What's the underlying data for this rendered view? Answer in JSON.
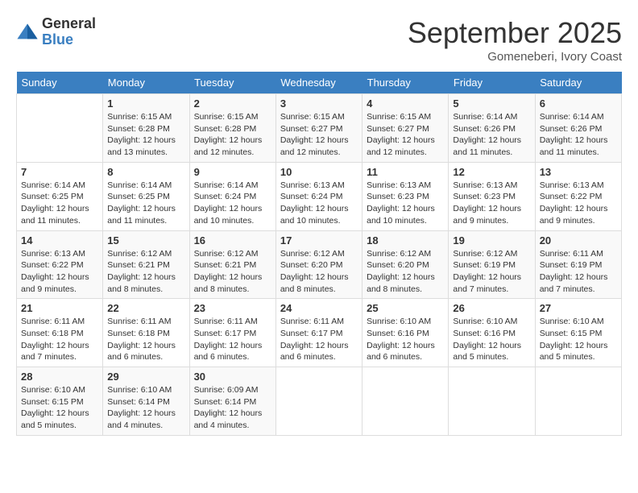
{
  "logo": {
    "line1": "General",
    "line2": "Blue"
  },
  "title": "September 2025",
  "subtitle": "Gomeneberi, Ivory Coast",
  "days_of_week": [
    "Sunday",
    "Monday",
    "Tuesday",
    "Wednesday",
    "Thursday",
    "Friday",
    "Saturday"
  ],
  "weeks": [
    [
      {
        "day": "",
        "info": ""
      },
      {
        "day": "1",
        "info": "Sunrise: 6:15 AM\nSunset: 6:28 PM\nDaylight: 12 hours\nand 13 minutes."
      },
      {
        "day": "2",
        "info": "Sunrise: 6:15 AM\nSunset: 6:28 PM\nDaylight: 12 hours\nand 12 minutes."
      },
      {
        "day": "3",
        "info": "Sunrise: 6:15 AM\nSunset: 6:27 PM\nDaylight: 12 hours\nand 12 minutes."
      },
      {
        "day": "4",
        "info": "Sunrise: 6:15 AM\nSunset: 6:27 PM\nDaylight: 12 hours\nand 12 minutes."
      },
      {
        "day": "5",
        "info": "Sunrise: 6:14 AM\nSunset: 6:26 PM\nDaylight: 12 hours\nand 11 minutes."
      },
      {
        "day": "6",
        "info": "Sunrise: 6:14 AM\nSunset: 6:26 PM\nDaylight: 12 hours\nand 11 minutes."
      }
    ],
    [
      {
        "day": "7",
        "info": "Sunrise: 6:14 AM\nSunset: 6:25 PM\nDaylight: 12 hours\nand 11 minutes."
      },
      {
        "day": "8",
        "info": "Sunrise: 6:14 AM\nSunset: 6:25 PM\nDaylight: 12 hours\nand 11 minutes."
      },
      {
        "day": "9",
        "info": "Sunrise: 6:14 AM\nSunset: 6:24 PM\nDaylight: 12 hours\nand 10 minutes."
      },
      {
        "day": "10",
        "info": "Sunrise: 6:13 AM\nSunset: 6:24 PM\nDaylight: 12 hours\nand 10 minutes."
      },
      {
        "day": "11",
        "info": "Sunrise: 6:13 AM\nSunset: 6:23 PM\nDaylight: 12 hours\nand 10 minutes."
      },
      {
        "day": "12",
        "info": "Sunrise: 6:13 AM\nSunset: 6:23 PM\nDaylight: 12 hours\nand 9 minutes."
      },
      {
        "day": "13",
        "info": "Sunrise: 6:13 AM\nSunset: 6:22 PM\nDaylight: 12 hours\nand 9 minutes."
      }
    ],
    [
      {
        "day": "14",
        "info": "Sunrise: 6:13 AM\nSunset: 6:22 PM\nDaylight: 12 hours\nand 9 minutes."
      },
      {
        "day": "15",
        "info": "Sunrise: 6:12 AM\nSunset: 6:21 PM\nDaylight: 12 hours\nand 8 minutes."
      },
      {
        "day": "16",
        "info": "Sunrise: 6:12 AM\nSunset: 6:21 PM\nDaylight: 12 hours\nand 8 minutes."
      },
      {
        "day": "17",
        "info": "Sunrise: 6:12 AM\nSunset: 6:20 PM\nDaylight: 12 hours\nand 8 minutes."
      },
      {
        "day": "18",
        "info": "Sunrise: 6:12 AM\nSunset: 6:20 PM\nDaylight: 12 hours\nand 8 minutes."
      },
      {
        "day": "19",
        "info": "Sunrise: 6:12 AM\nSunset: 6:19 PM\nDaylight: 12 hours\nand 7 minutes."
      },
      {
        "day": "20",
        "info": "Sunrise: 6:11 AM\nSunset: 6:19 PM\nDaylight: 12 hours\nand 7 minutes."
      }
    ],
    [
      {
        "day": "21",
        "info": "Sunrise: 6:11 AM\nSunset: 6:18 PM\nDaylight: 12 hours\nand 7 minutes."
      },
      {
        "day": "22",
        "info": "Sunrise: 6:11 AM\nSunset: 6:18 PM\nDaylight: 12 hours\nand 6 minutes."
      },
      {
        "day": "23",
        "info": "Sunrise: 6:11 AM\nSunset: 6:17 PM\nDaylight: 12 hours\nand 6 minutes."
      },
      {
        "day": "24",
        "info": "Sunrise: 6:11 AM\nSunset: 6:17 PM\nDaylight: 12 hours\nand 6 minutes."
      },
      {
        "day": "25",
        "info": "Sunrise: 6:10 AM\nSunset: 6:16 PM\nDaylight: 12 hours\nand 6 minutes."
      },
      {
        "day": "26",
        "info": "Sunrise: 6:10 AM\nSunset: 6:16 PM\nDaylight: 12 hours\nand 5 minutes."
      },
      {
        "day": "27",
        "info": "Sunrise: 6:10 AM\nSunset: 6:15 PM\nDaylight: 12 hours\nand 5 minutes."
      }
    ],
    [
      {
        "day": "28",
        "info": "Sunrise: 6:10 AM\nSunset: 6:15 PM\nDaylight: 12 hours\nand 5 minutes."
      },
      {
        "day": "29",
        "info": "Sunrise: 6:10 AM\nSunset: 6:14 PM\nDaylight: 12 hours\nand 4 minutes."
      },
      {
        "day": "30",
        "info": "Sunrise: 6:09 AM\nSunset: 6:14 PM\nDaylight: 12 hours\nand 4 minutes."
      },
      {
        "day": "",
        "info": ""
      },
      {
        "day": "",
        "info": ""
      },
      {
        "day": "",
        "info": ""
      },
      {
        "day": "",
        "info": ""
      }
    ]
  ]
}
